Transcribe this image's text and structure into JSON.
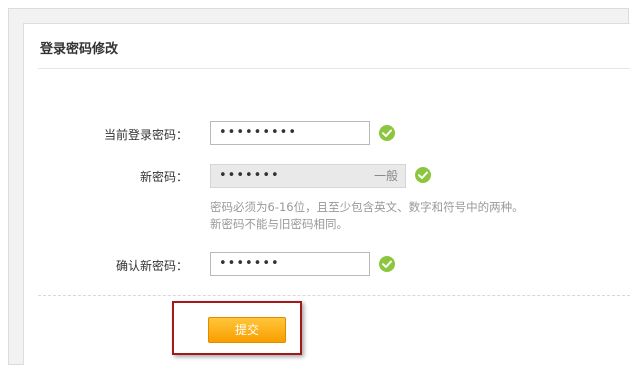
{
  "panel": {
    "title": "登录密码修改"
  },
  "form": {
    "current_password": {
      "label": "当前登录密码：",
      "value": "•••••••••"
    },
    "new_password": {
      "label": "新密码：",
      "value": "•••••••",
      "strength": "一般"
    },
    "hint": {
      "line1": "密码必须为6-16位，且至少包含英文、数字和符号中的两种。",
      "line2": "新密码不能与旧密码相同。"
    },
    "confirm_password": {
      "label": "确认新密码：",
      "value": "•••••••"
    },
    "submit_label": "提交"
  },
  "colors": {
    "accent_button": "#f99e00",
    "ok_icon": "#8cc63f",
    "highlight_border": "#a31818"
  },
  "icons": [
    "check-circle-icon"
  ]
}
